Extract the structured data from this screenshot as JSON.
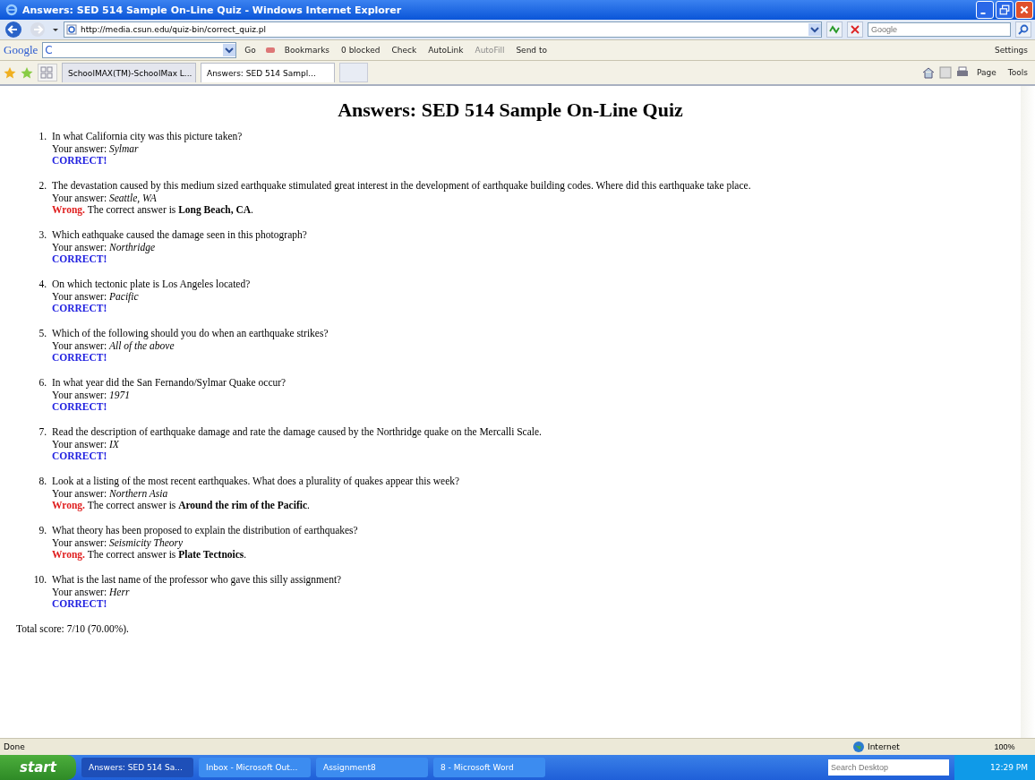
{
  "window": {
    "title": "Answers: SED 514 Sample On-Line Quiz - Windows Internet Explorer"
  },
  "address_bar": {
    "url": "http://media.csun.edu/quiz-bin/correct_quiz.pl",
    "search_placeholder": "Google"
  },
  "google_toolbar": {
    "logo": "Google",
    "letter": "C",
    "items": [
      {
        "label": "Go",
        "disabled": false
      },
      {
        "label": "Bookmarks",
        "disabled": false
      },
      {
        "label": "0 blocked",
        "disabled": false
      },
      {
        "label": "Check",
        "disabled": false
      },
      {
        "label": "AutoLink",
        "disabled": false
      },
      {
        "label": "AutoFill",
        "disabled": true
      },
      {
        "label": "Send to",
        "disabled": false
      }
    ],
    "settings": "Settings"
  },
  "tabs": [
    {
      "label": "SchoolMAX(TM)-SchoolMax L...",
      "selected": false
    },
    {
      "label": "Answers: SED 514 Sampl...",
      "selected": true
    }
  ],
  "commands": [
    "Page",
    "Tools"
  ],
  "page": {
    "heading": "Answers: SED 514 Sample On-Line Quiz",
    "questions": [
      {
        "number": "1.",
        "question": "In what California city was this picture taken?",
        "answer_label": "Your answer:",
        "answer": "Sylmar",
        "result": {
          "kind": "correct",
          "label": "CORRECT!"
        }
      },
      {
        "number": "2.",
        "question": "The devastation caused by this medium sized earthquake stimulated great interest in the development of earthquake building codes. Where did this earthquake take place.",
        "answer_label": "Your answer:",
        "answer": "Seattle, WA",
        "result": {
          "kind": "wrong",
          "label": "Wrong.",
          "note": "The correct answer is **Long Beach, CA**."
        }
      },
      {
        "number": "3.",
        "question": "Which eathquake caused the damage seen in this photograph?",
        "answer_label": "Your answer:",
        "answer": "Northridge",
        "result": {
          "kind": "correct",
          "label": "CORRECT!"
        }
      },
      {
        "number": "4.",
        "question": "On which tectonic plate is Los Angeles located?",
        "answer_label": "Your answer:",
        "answer": "Pacific",
        "result": {
          "kind": "correct",
          "label": "CORRECT!"
        }
      },
      {
        "number": "5.",
        "question": "Which of the following should you do when an earthquake strikes?",
        "answer_label": "Your answer:",
        "answer": "All of the above",
        "result": {
          "kind": "correct",
          "label": "CORRECT!"
        }
      },
      {
        "number": "6.",
        "question": "In what year did the San Fernando/Sylmar Quake occur?",
        "answer_label": "Your answer:",
        "answer": "1971",
        "result": {
          "kind": "correct",
          "label": "CORRECT!"
        }
      },
      {
        "number": "7.",
        "question": "Read the description of earthquake damage and rate the damage caused by the Northridge quake on the Mercalli Scale.",
        "answer_label": "Your answer:",
        "answer": "IX",
        "result": {
          "kind": "correct",
          "label": "CORRECT!"
        }
      },
      {
        "number": "8.",
        "question": "Look at a listing of the most recent earthquakes. What does a plurality of quakes appear this week?",
        "answer_label": "Your answer:",
        "answer": "Northern Asia",
        "result": {
          "kind": "wrong",
          "label": "Wrong.",
          "note": "The correct answer is **Around the rim of the Pacific**."
        }
      },
      {
        "number": "9.",
        "question": "What theory has been proposed to explain the distribution of earthquakes?",
        "answer_label": "Your answer:",
        "answer": "Seismicity Theory",
        "result": {
          "kind": "wrong",
          "label": "Wrong.",
          "note": "The correct answer is **Plate Tectnoics**."
        }
      },
      {
        "number": "10.",
        "question": "What is the last name of the professor who gave this silly assignment?",
        "answer_label": "Your answer:",
        "answer": "Herr",
        "result": {
          "kind": "correct",
          "label": "CORRECT!"
        }
      }
    ],
    "total": "Total score: 7/10 (70.00%)."
  },
  "status_bar": {
    "status": "Done",
    "zone": "Internet",
    "zoom": "100%"
  },
  "taskbar": {
    "start": "start",
    "tasks": [
      {
        "label": "Answers: SED 514 Sa...",
        "selected": true
      },
      {
        "label": "Inbox - Microsoft Out...",
        "selected": false
      },
      {
        "label": "Assignment8",
        "selected": false
      },
      {
        "label": "8 - Microsoft Word",
        "selected": false
      }
    ],
    "search_placeholder": "Search Desktop",
    "clock": "12:29 PM"
  }
}
